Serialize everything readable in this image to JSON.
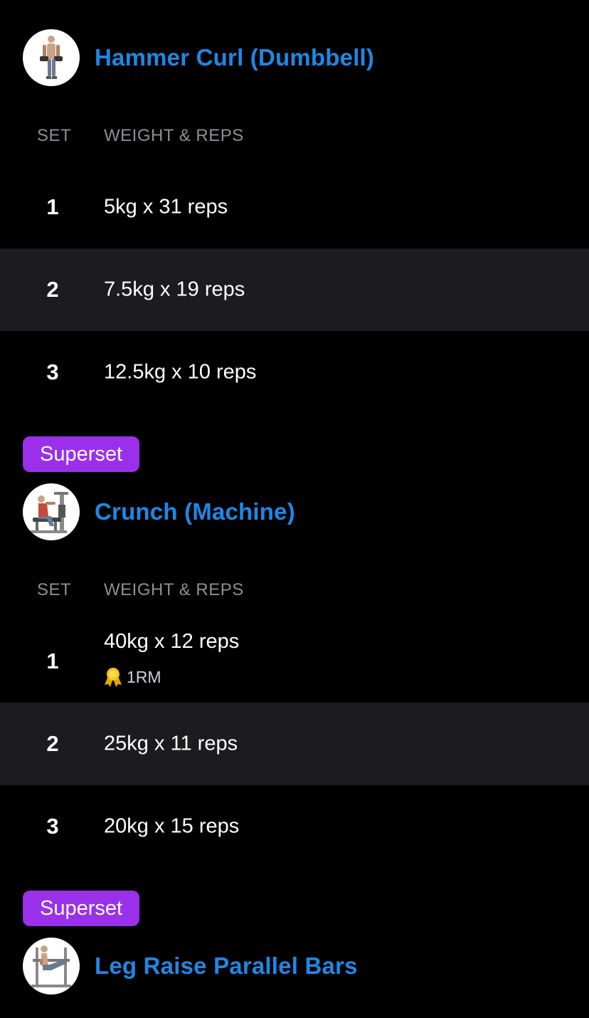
{
  "colors": {
    "background": "#000000",
    "alt_row": "#1c1c1e",
    "link_blue": "#1e88e5",
    "superset_purple": "#9b30ea",
    "header_gray": "#8e8e93",
    "medal_gold": "#f5c518"
  },
  "exercises": [
    {
      "title": "Hammer Curl (Dumbbell)",
      "thumbnail_icon": "dumbbell-curl-figure-icon",
      "columns": {
        "set": "SET",
        "weight_reps": "WEIGHT & REPS"
      },
      "sets": [
        {
          "num": "1",
          "value": "5kg x 31 reps"
        },
        {
          "num": "2",
          "value": "7.5kg x 19 reps"
        },
        {
          "num": "3",
          "value": "12.5kg x 10 reps"
        }
      ]
    },
    {
      "superset_label": "Superset",
      "title": "Crunch (Machine)",
      "thumbnail_icon": "crunch-machine-figure-icon",
      "columns": {
        "set": "SET",
        "weight_reps": "WEIGHT & REPS"
      },
      "sets": [
        {
          "num": "1",
          "value": "40kg x 12 reps",
          "badge": {
            "icon": "medal-icon",
            "label": "1RM"
          }
        },
        {
          "num": "2",
          "value": "25kg x 11 reps"
        },
        {
          "num": "3",
          "value": "20kg x 15 reps"
        }
      ]
    },
    {
      "superset_label": "Superset",
      "title": "Leg Raise Parallel Bars",
      "thumbnail_icon": "leg-raise-figure-icon"
    }
  ]
}
